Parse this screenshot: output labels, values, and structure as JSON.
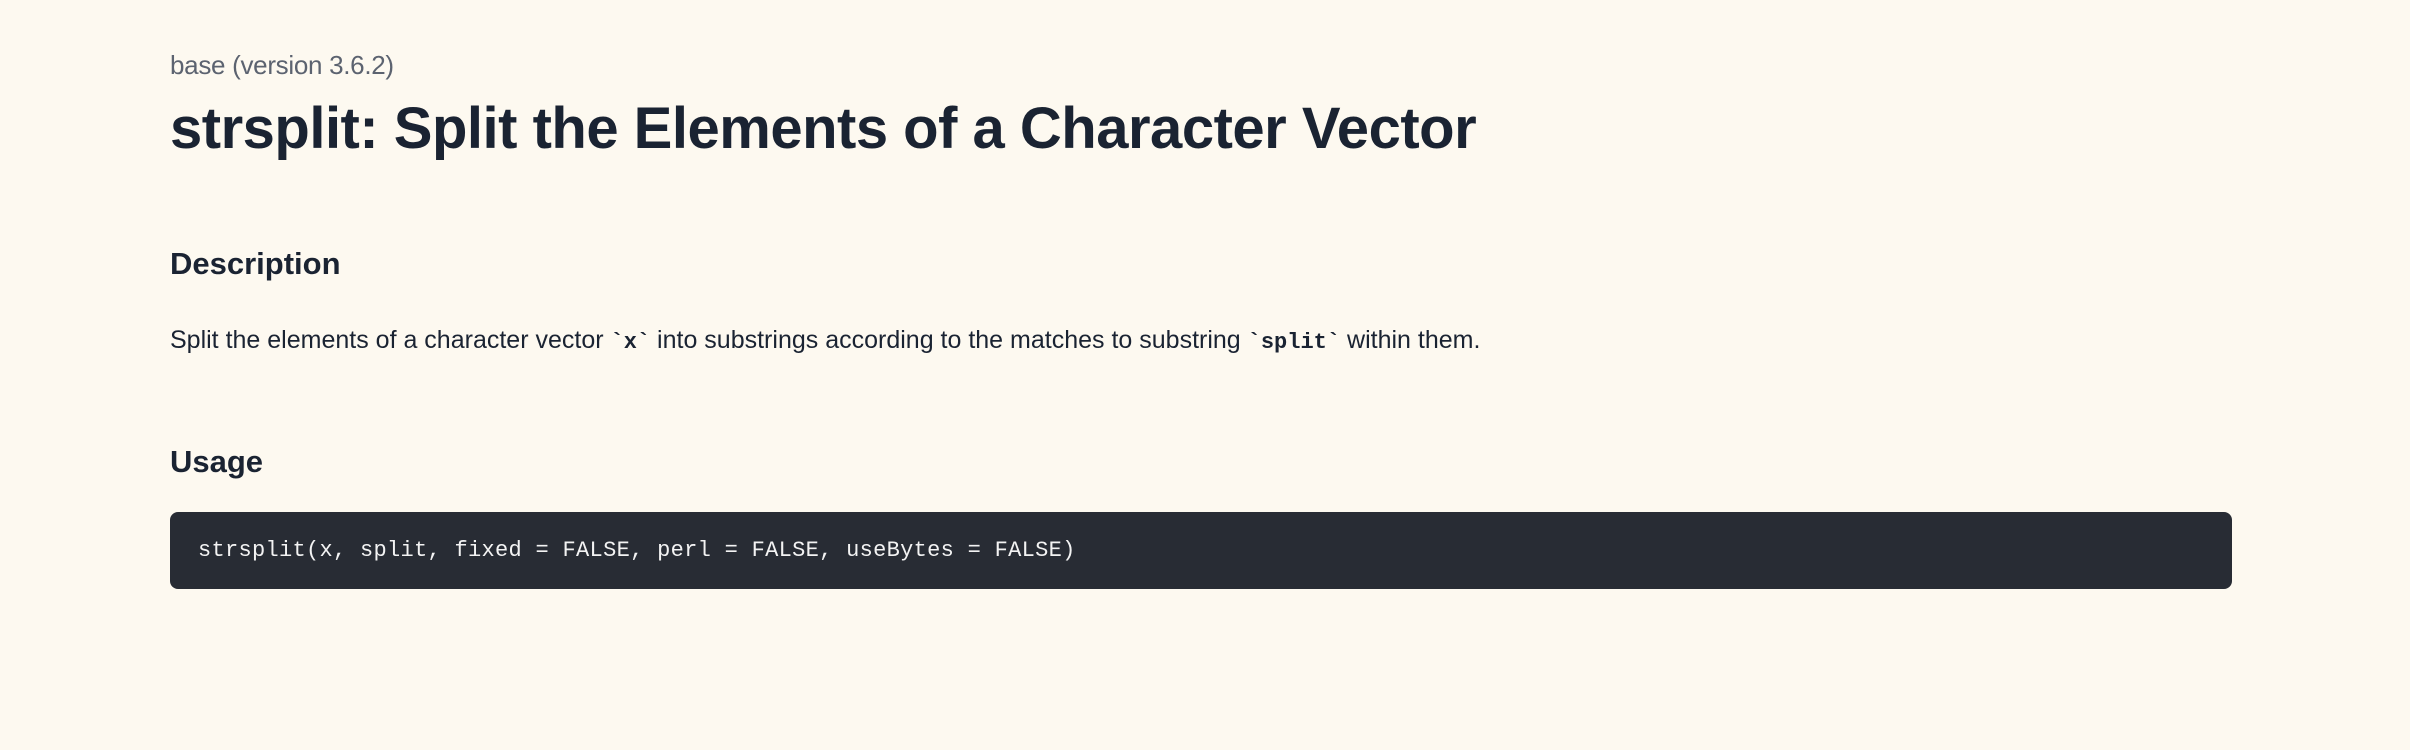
{
  "header": {
    "package_version": "base (version 3.6.2)",
    "page_title": "strsplit: Split the Elements of a Character Vector"
  },
  "description": {
    "heading": "Description",
    "text_pre": "Split the elements of a character vector ",
    "code1": "`x`",
    "text_mid": " into substrings according to the matches to substring ",
    "code2": "`split`",
    "text_post": " within them."
  },
  "usage": {
    "heading": "Usage",
    "code": "strsplit(x, split, fixed = FALSE, perl = FALSE, useBytes = FALSE)"
  }
}
